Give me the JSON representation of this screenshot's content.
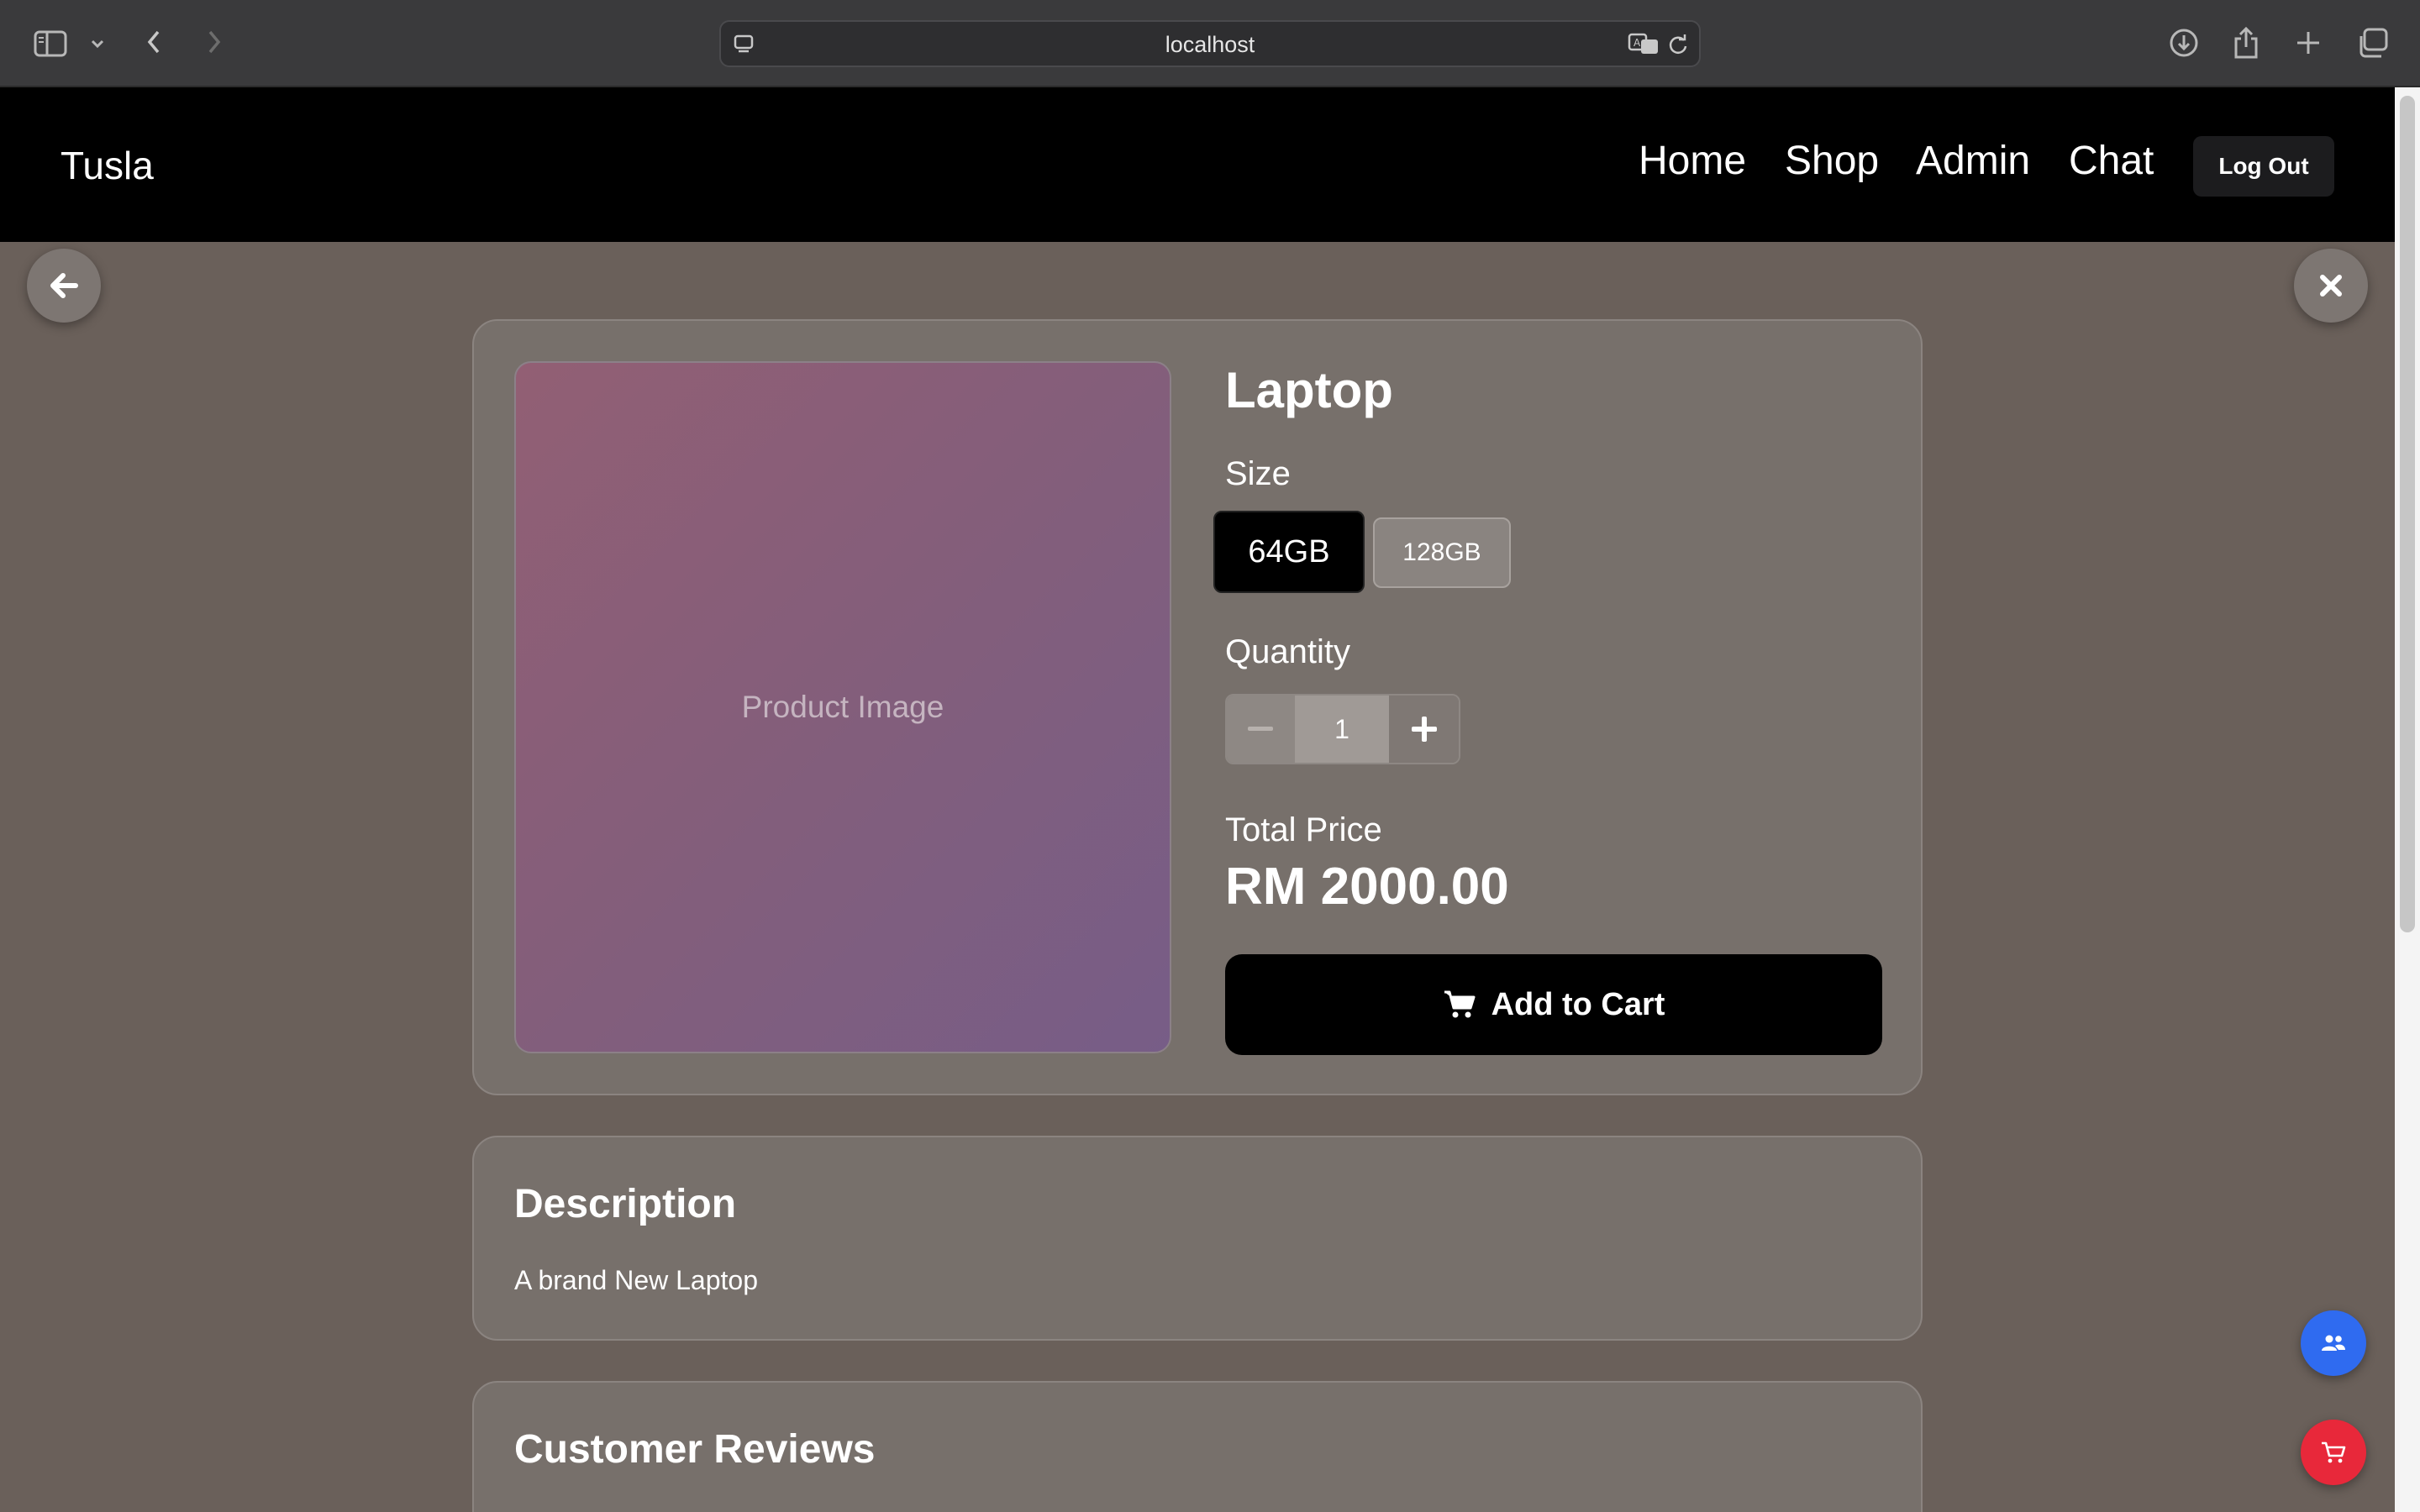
{
  "browser": {
    "url": "localhost"
  },
  "nav": {
    "brand": "Tusla",
    "links": [
      {
        "label": "Home"
      },
      {
        "label": "Shop"
      },
      {
        "label": "Admin"
      },
      {
        "label": "Chat"
      }
    ],
    "logout_label": "Log Out"
  },
  "product": {
    "image_placeholder": "Product Image",
    "title": "Laptop",
    "size_label": "Size",
    "sizes": [
      {
        "label": "64GB",
        "selected": true
      },
      {
        "label": "128GB",
        "selected": false
      }
    ],
    "quantity_label": "Quantity",
    "quantity_value": "1",
    "total_label": "Total Price",
    "total_value": "RM 2000.00",
    "add_to_cart_label": "Add to Cart"
  },
  "description": {
    "title": "Description",
    "text": "A brand New Laptop"
  },
  "reviews": {
    "title": "Customer Reviews"
  },
  "colors": {
    "page_bg": "#6a605a",
    "card_bg": "#77706b",
    "nav_bg": "#000000",
    "chat_fab": "#2f6bf0",
    "cart_fab": "#e8283a"
  },
  "icons": {
    "back": "arrow-left-icon",
    "close": "close-icon",
    "chat": "users-icon",
    "cart": "shopping-cart-icon"
  }
}
